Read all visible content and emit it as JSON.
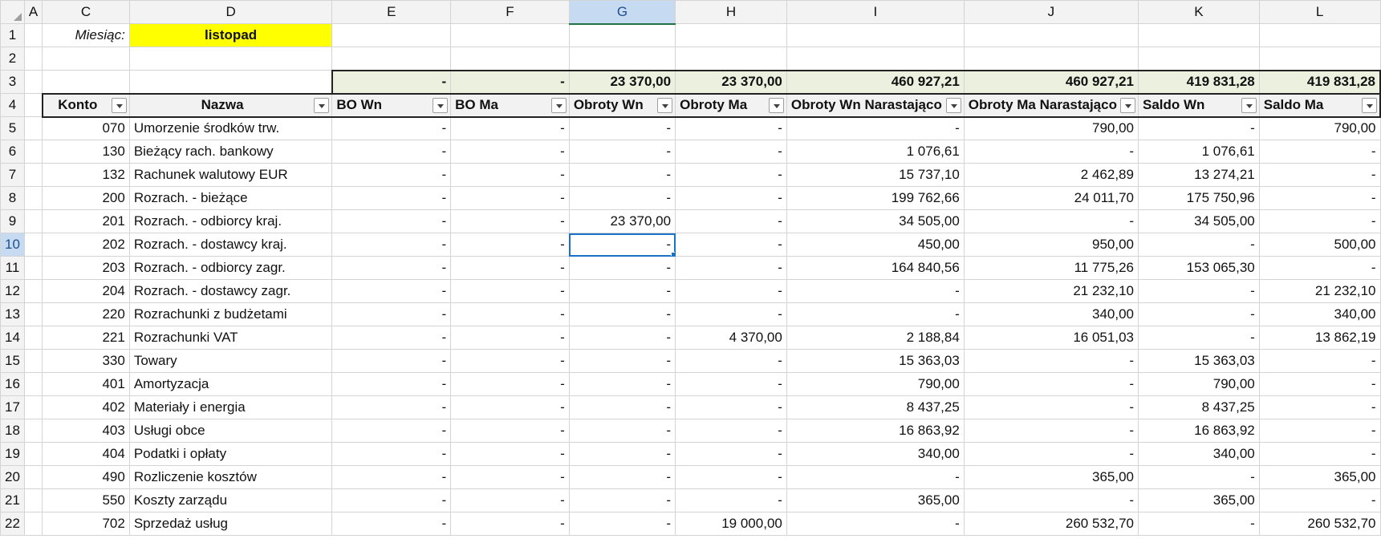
{
  "columns": [
    "A",
    "C",
    "D",
    "E",
    "F",
    "G",
    "H",
    "I",
    "J",
    "K",
    "L"
  ],
  "row_numbers": [
    "1",
    "2",
    "3",
    "4",
    "5",
    "6",
    "7",
    "8",
    "9",
    "10",
    "11",
    "12",
    "13",
    "14",
    "15",
    "16",
    "17",
    "18",
    "19",
    "20",
    "21",
    "22"
  ],
  "month": {
    "label": "Miesiąc:",
    "value": "listopad"
  },
  "totals": [
    "-",
    "-",
    "23 370,00",
    "23 370,00",
    "460 927,21",
    "460 927,21",
    "419 831,28",
    "419 831,28"
  ],
  "headers": [
    "Konto",
    "Nazwa",
    "BO Wn",
    "BO Ma",
    "Obroty Wn",
    "Obroty Ma",
    "Obroty Wn Narastająco",
    "Obroty Ma Narastająco",
    "Saldo Wn",
    "Saldo Ma"
  ],
  "rows": [
    [
      "070",
      "Umorzenie środków trw.",
      "-",
      "-",
      "-",
      "-",
      "-",
      "790,00",
      "-",
      "790,00"
    ],
    [
      "130",
      "Bieżący rach. bankowy",
      "-",
      "-",
      "-",
      "-",
      "1 076,61",
      "-",
      "1 076,61",
      "-"
    ],
    [
      "132",
      "Rachunek walutowy EUR",
      "-",
      "-",
      "-",
      "-",
      "15 737,10",
      "2 462,89",
      "13 274,21",
      "-"
    ],
    [
      "200",
      "Rozrach. - bieżące",
      "-",
      "-",
      "-",
      "-",
      "199 762,66",
      "24 011,70",
      "175 750,96",
      "-"
    ],
    [
      "201",
      "Rozrach. - odbiorcy kraj.",
      "-",
      "-",
      "23 370,00",
      "-",
      "34 505,00",
      "-",
      "34 505,00",
      "-"
    ],
    [
      "202",
      "Rozrach. - dostawcy kraj.",
      "-",
      "-",
      "-",
      "-",
      "450,00",
      "950,00",
      "-",
      "500,00"
    ],
    [
      "203",
      "Rozrach. - odbiorcy zagr.",
      "-",
      "-",
      "-",
      "-",
      "164 840,56",
      "11 775,26",
      "153 065,30",
      "-"
    ],
    [
      "204",
      "Rozrach. - dostawcy zagr.",
      "-",
      "-",
      "-",
      "-",
      "-",
      "21 232,10",
      "-",
      "21 232,10"
    ],
    [
      "220",
      "Rozrachunki z budżetami",
      "-",
      "-",
      "-",
      "-",
      "-",
      "340,00",
      "-",
      "340,00"
    ],
    [
      "221",
      "Rozrachunki VAT",
      "-",
      "-",
      "-",
      "4 370,00",
      "2 188,84",
      "16 051,03",
      "-",
      "13 862,19"
    ],
    [
      "330",
      "Towary",
      "-",
      "-",
      "-",
      "-",
      "15 363,03",
      "-",
      "15 363,03",
      "-"
    ],
    [
      "401",
      "Amortyzacja",
      "-",
      "-",
      "-",
      "-",
      "790,00",
      "-",
      "790,00",
      "-"
    ],
    [
      "402",
      "Materiały i energia",
      "-",
      "-",
      "-",
      "-",
      "8 437,25",
      "-",
      "8 437,25",
      "-"
    ],
    [
      "403",
      "Usługi obce",
      "-",
      "-",
      "-",
      "-",
      "16 863,92",
      "-",
      "16 863,92",
      "-"
    ],
    [
      "404",
      "Podatki i opłaty",
      "-",
      "-",
      "-",
      "-",
      "340,00",
      "-",
      "340,00",
      "-"
    ],
    [
      "490",
      "Rozliczenie kosztów",
      "-",
      "-",
      "-",
      "-",
      "-",
      "365,00",
      "-",
      "365,00"
    ],
    [
      "550",
      "Koszty zarządu",
      "-",
      "-",
      "-",
      "-",
      "365,00",
      "-",
      "365,00",
      "-"
    ],
    [
      "702",
      "Sprzedaż usług",
      "-",
      "-",
      "-",
      "19 000,00",
      "-",
      "260 532,70",
      "-",
      "260 532,70"
    ]
  ],
  "icons": {
    "filter": "filter-dropdown-icon",
    "select_all": "select-all-triangle-icon"
  },
  "colors": {
    "month_highlight": "#ffff00",
    "totals_fill": "#ebf1de",
    "selection": "#1a73c8"
  }
}
